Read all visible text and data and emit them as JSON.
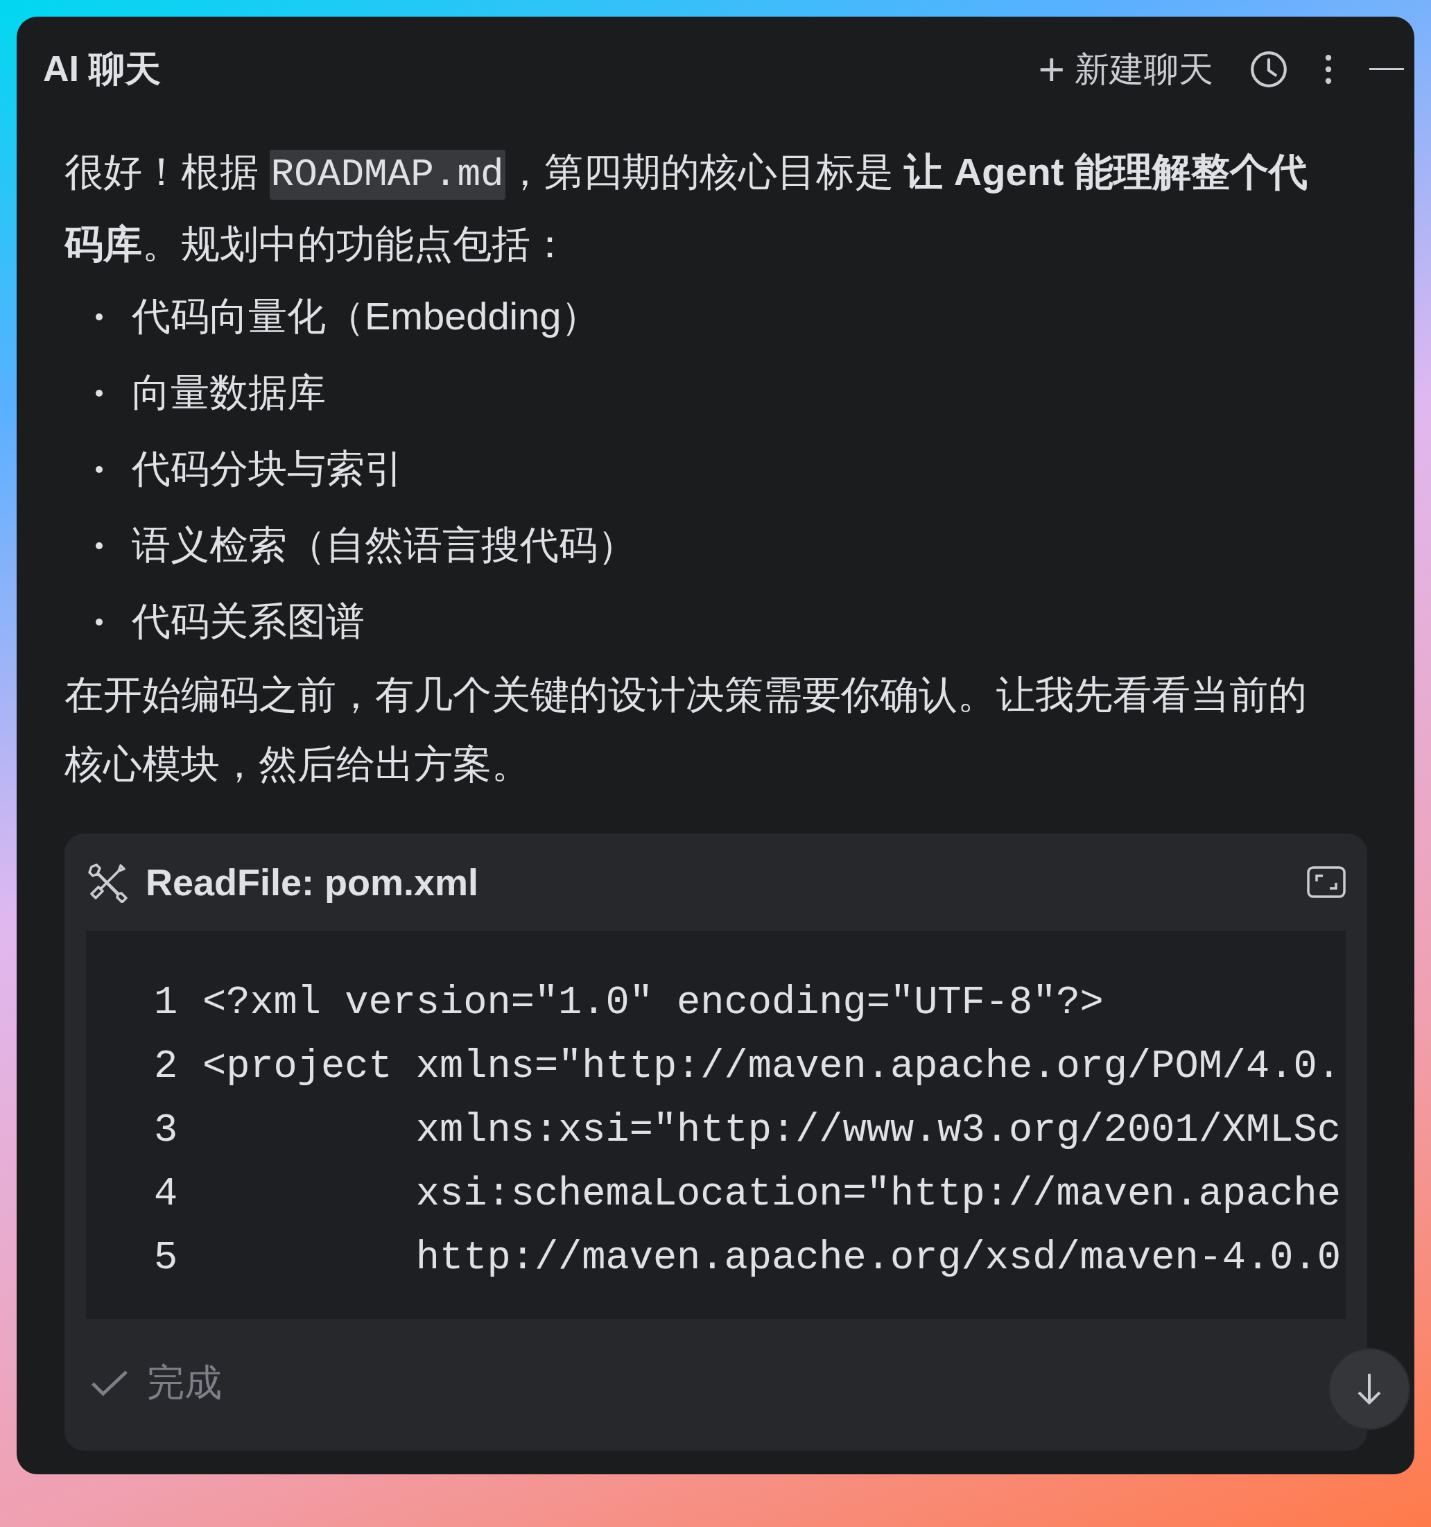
{
  "window": {
    "title": "AI 聊天"
  },
  "toolbar": {
    "new_chat": {
      "icon": "+",
      "label": "新建聊天"
    }
  },
  "message": {
    "intro": [
      {
        "kind": "text",
        "text": "很好！根据 "
      },
      {
        "kind": "code",
        "text": "ROADMAP.md"
      },
      {
        "kind": "text",
        "text": "，第四期的核心目标是 **让 Agent 能理解整个代码库**。规划中的功能点包括："
      }
    ],
    "bullets": [
      "代码向量化（Embedding）",
      "向量数据库",
      "代码分块与索引",
      "语义检索（自然语言搜代码）",
      "代码关系图谱"
    ],
    "outro": "在开始编码之前，有几个关键的设计决策需要你确认。让我先看看当前的核心模块，然后给出方案。"
  },
  "tool_card": {
    "title": "ReadFile: pom.xml",
    "lines": [
      {
        "number": "1",
        "text": "<?xml version=\"1.0\" encoding=\"UTF-8\"?>"
      },
      {
        "number": "2",
        "text": "<project xmlns=\"http://maven.apache.org/POM/4.0."
      },
      {
        "number": "3",
        "text": "         xmlns:xsi=\"http://www.w3.org/2001/XMLSc"
      },
      {
        "number": "4",
        "text": "         xsi:schemaLocation=\"http://maven.apache"
      },
      {
        "number": "5",
        "text": "         http://maven.apache.org/xsd/maven-4.0.0"
      }
    ],
    "status": {
      "label": "完成"
    }
  }
}
